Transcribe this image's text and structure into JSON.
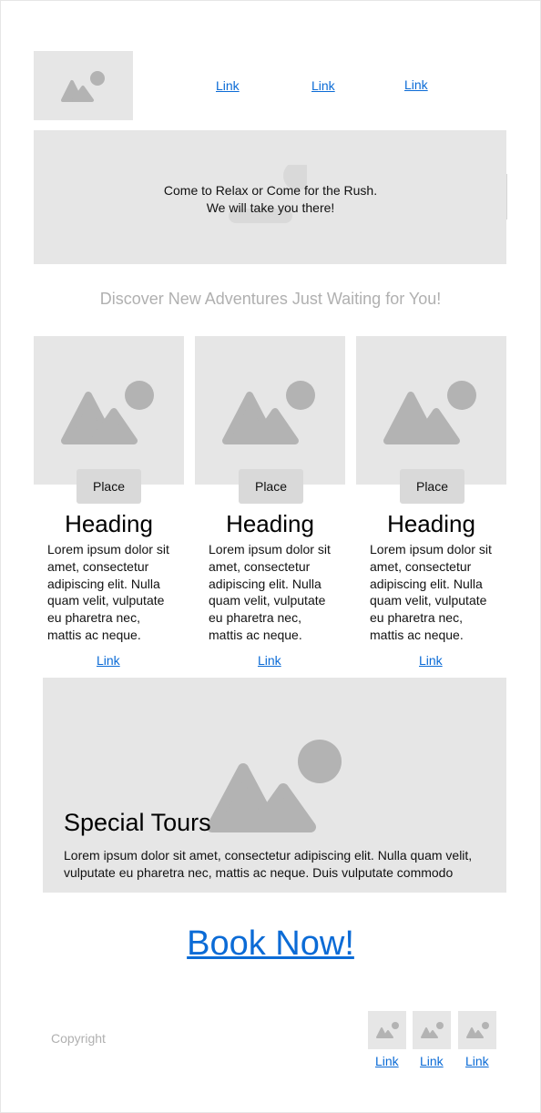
{
  "header": {
    "logo_icon": "image-placeholder-icon",
    "nav_links": [
      "Link",
      "Link",
      "Link"
    ]
  },
  "hero": {
    "line1": "Come to Relax or Come for the Rush.",
    "line2": "We will take you there!"
  },
  "tagline": "Discover New Adventures Just Waiting for You!",
  "cards": [
    {
      "button": "Place",
      "heading": "Heading",
      "body": "Lorem ipsum dolor sit amet, consectetur adipiscing elit. Nulla quam velit, vulputate eu pharetra nec, mattis ac neque.",
      "link": "Link"
    },
    {
      "button": "Place",
      "heading": "Heading",
      "body": "Lorem ipsum dolor sit amet, consectetur adipiscing elit. Nulla quam velit, vulputate eu pharetra nec, mattis ac neque.",
      "link": "Link"
    },
    {
      "button": "Place",
      "heading": "Heading",
      "body": "Lorem ipsum dolor sit amet, consectetur adipiscing elit. Nulla quam velit, vulputate eu pharetra nec, mattis ac neque.",
      "link": "Link"
    }
  ],
  "special": {
    "title": "Special Tours",
    "body": "Lorem ipsum dolor sit amet, consectetur adipiscing elit. Nulla quam velit, vulputate eu pharetra nec, mattis ac neque. Duis vulputate commodo"
  },
  "cta": "Book Now!",
  "footer": {
    "copyright": "Copyright",
    "social_links": [
      "Link",
      "Link",
      "Link"
    ]
  },
  "colors": {
    "placeholder": "#e6e6e6",
    "icon": "#b3b3b3",
    "link": "#0b6bd6"
  }
}
